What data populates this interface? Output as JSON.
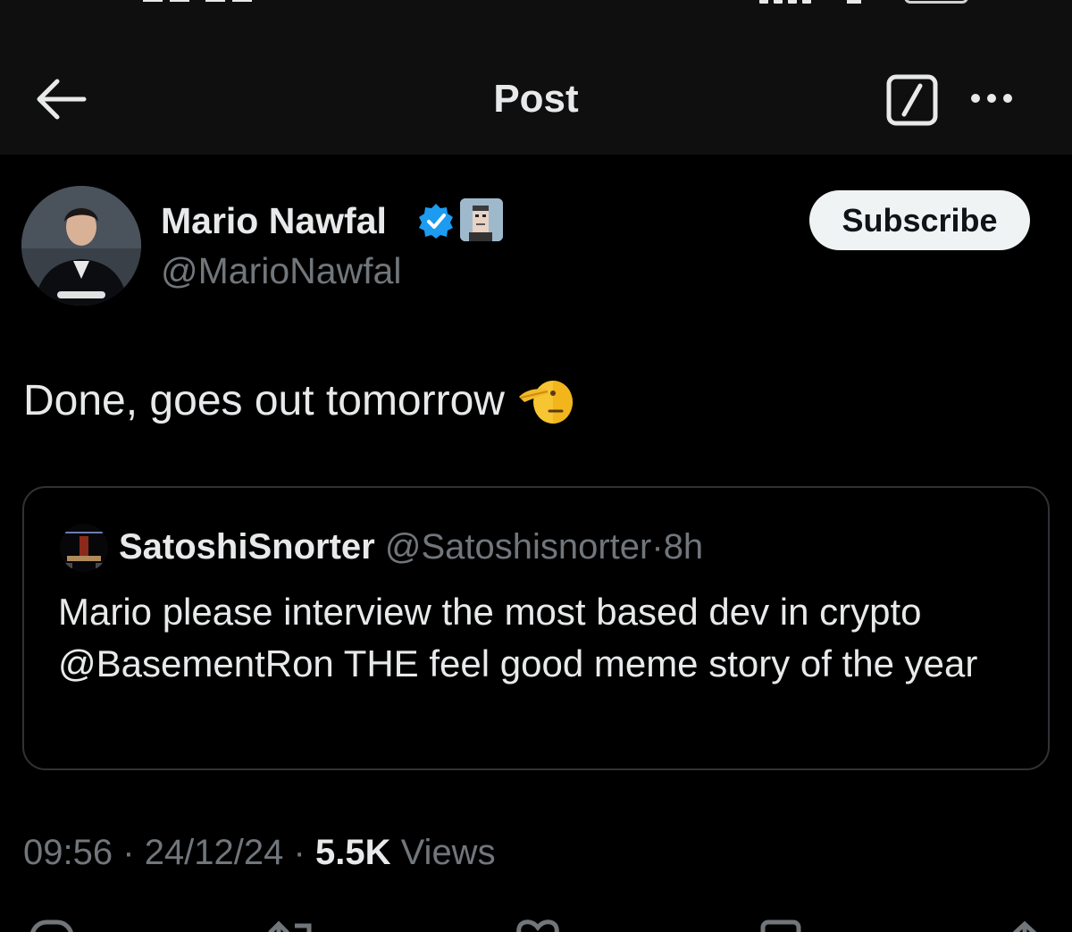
{
  "header": {
    "title": "Post"
  },
  "author": {
    "name": "Mario Nawfal",
    "handle": "@MarioNawfal",
    "subscribe_label": "Subscribe"
  },
  "tweet": {
    "text": "Done, goes out tomorrow"
  },
  "quote": {
    "name": "SatoshiSnorter",
    "handle": "@Satoshisnorter",
    "separator": "·",
    "time": "8h",
    "text": "Mario please interview the most based dev in crypto @BasementRon THE feel good meme story of the year"
  },
  "meta": {
    "time": "09:56",
    "date": "24/12/24",
    "separator": "·",
    "views_count": "5.5K",
    "views_label": "Views"
  },
  "colors": {
    "background": "#000000",
    "topbar": "#0f0f0f",
    "text": "#e7e9ea",
    "muted": "#71767b",
    "verified": "#1d9bf0",
    "border": "#2f3336"
  },
  "icons": {
    "back": "arrow-left-icon",
    "edit": "square-slash-icon",
    "more": "more-horizontal-icon",
    "verified": "verified-badge-icon",
    "emoji": "saluting-face-emoji",
    "actions": [
      "reply-icon",
      "repost-icon",
      "like-icon",
      "bookmark-icon",
      "share-icon"
    ]
  }
}
